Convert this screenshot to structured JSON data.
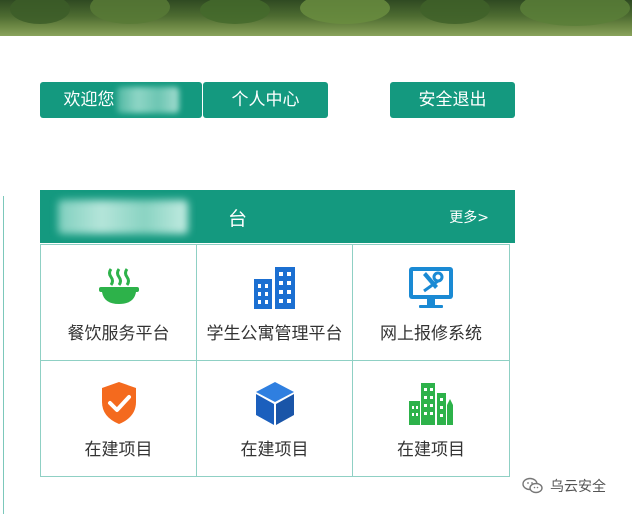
{
  "header": {
    "welcome_label": "欢迎您",
    "personal_center_label": "个人中心",
    "logout_label": "安全退出"
  },
  "panel": {
    "title_visible": "台",
    "more_label": "更多>"
  },
  "tiles": [
    {
      "label": "餐饮服务平台",
      "icon": "food-bowl-icon"
    },
    {
      "label": "学生公寓管理平台",
      "icon": "buildings-icon"
    },
    {
      "label": "网上报修系统",
      "icon": "repair-monitor-icon"
    },
    {
      "label": "在建项目",
      "icon": "shield-check-icon"
    },
    {
      "label": "在建项目",
      "icon": "cube-icon"
    },
    {
      "label": "在建项目",
      "icon": "city-buildings-icon"
    }
  ],
  "watermark": {
    "text": "乌云安全",
    "icon": "wechat-icon"
  },
  "colors": {
    "primary": "#14997f",
    "border": "#8fd0c4"
  }
}
